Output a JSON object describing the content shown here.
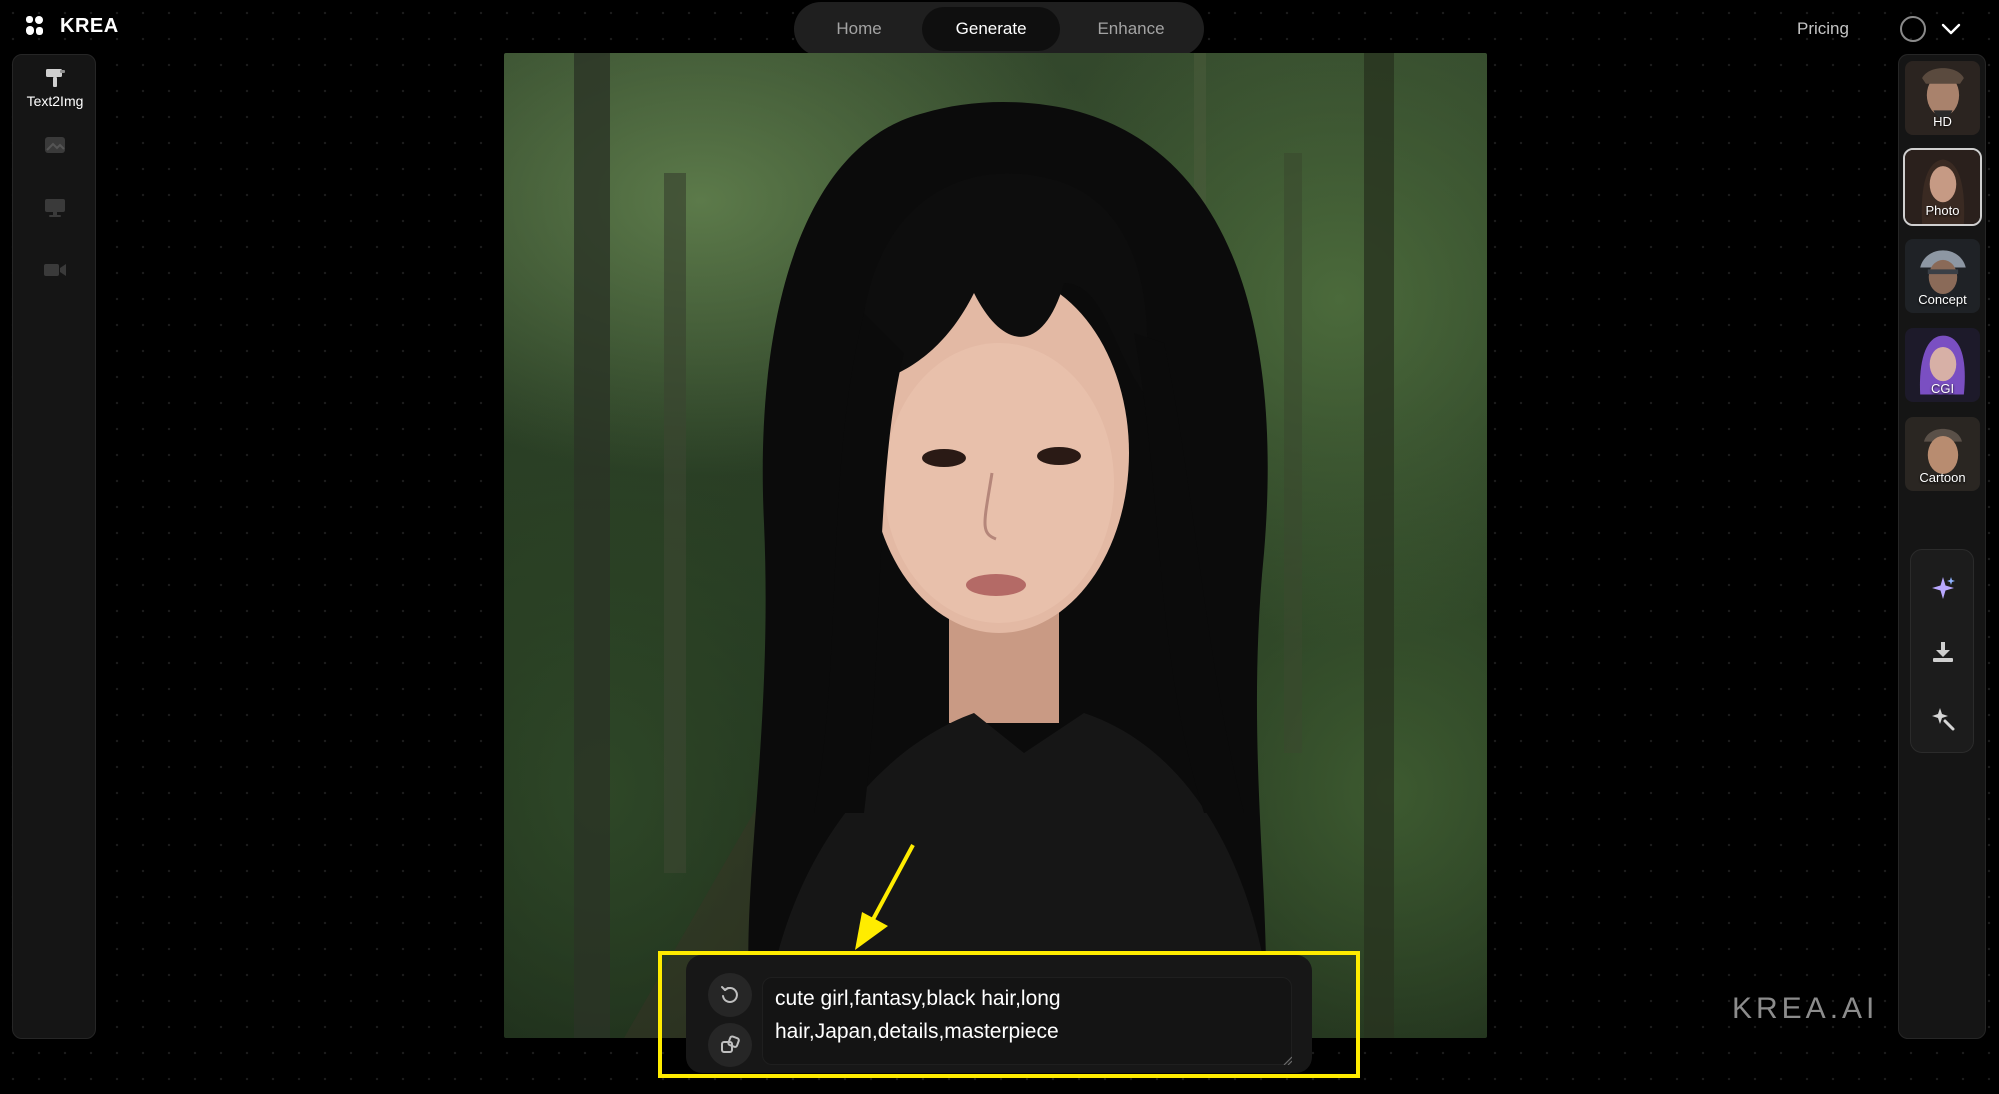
{
  "brand": {
    "name": "KREA",
    "watermark": "KREA.AI"
  },
  "top_nav": {
    "tabs": [
      {
        "label": "Home"
      },
      {
        "label": "Generate"
      },
      {
        "label": "Enhance"
      }
    ],
    "active": "Generate"
  },
  "header": {
    "pricing_label": "Pricing"
  },
  "left_rail": {
    "items": [
      {
        "label": "Text2Img",
        "icon": "text2img-icon"
      },
      {
        "icon": "image-icon"
      },
      {
        "icon": "monitor-icon"
      },
      {
        "icon": "video-icon"
      }
    ]
  },
  "right_rail": {
    "styles": [
      {
        "label": "HD"
      },
      {
        "label": "Photo"
      },
      {
        "label": "Concept"
      },
      {
        "label": "CGI"
      },
      {
        "label": "Cartoon"
      }
    ],
    "active_style": "Photo",
    "tools": [
      {
        "icon": "sparkle-enhance-icon"
      },
      {
        "icon": "download-icon"
      },
      {
        "icon": "magic-wand-icon"
      }
    ]
  },
  "prompt": {
    "value": "cute girl,fantasy,black hair,long hair,Japan,details,masterpiece"
  },
  "colors": {
    "highlight": "#ffec00",
    "background": "#000000",
    "panel": "#171717"
  }
}
